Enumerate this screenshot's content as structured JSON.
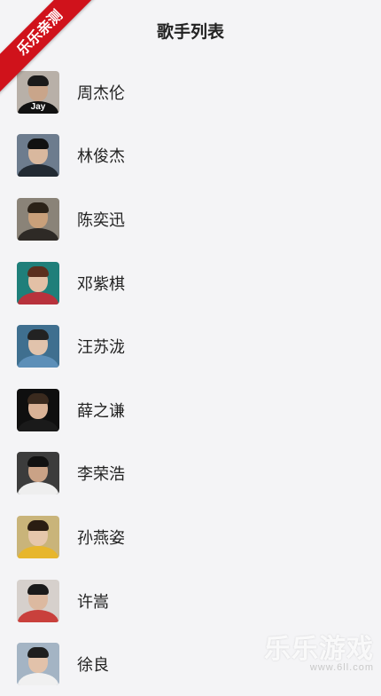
{
  "header": {
    "title": "歌手列表"
  },
  "ribbon": {
    "label": "乐乐亲测"
  },
  "singers": [
    {
      "name": "周杰伦",
      "tag": "Jay",
      "colors": {
        "bg": "#b8b0a8",
        "hair": "#1a1a1a",
        "skin": "#c9a58a",
        "cloth": "#111111"
      }
    },
    {
      "name": "林俊杰",
      "tag": "",
      "colors": {
        "bg": "#6d7c8e",
        "hair": "#111111",
        "skin": "#d9b89e",
        "cloth": "#222a33"
      }
    },
    {
      "name": "陈奕迅",
      "tag": "",
      "colors": {
        "bg": "#8a8378",
        "hair": "#2b2218",
        "skin": "#c9a07a",
        "cloth": "#2e2a26"
      }
    },
    {
      "name": "邓紫棋",
      "tag": "",
      "colors": {
        "bg": "#1f7f7a",
        "hair": "#5b2f1e",
        "skin": "#e3c0a6",
        "cloth": "#b8323c"
      }
    },
    {
      "name": "汪苏泷",
      "tag": "",
      "colors": {
        "bg": "#3f6f8f",
        "hair": "#222222",
        "skin": "#e1c3ac",
        "cloth": "#5d8fb8"
      }
    },
    {
      "name": "薛之谦",
      "tag": "",
      "colors": {
        "bg": "#0f0f0f",
        "hair": "#3a2a1e",
        "skin": "#d9b296",
        "cloth": "#1a1a1a"
      }
    },
    {
      "name": "李荣浩",
      "tag": "",
      "colors": {
        "bg": "#3c3c3c",
        "hair": "#111111",
        "skin": "#caa286",
        "cloth": "#eeeeee"
      }
    },
    {
      "name": "孙燕姿",
      "tag": "",
      "colors": {
        "bg": "#c9b47a",
        "hair": "#2a1d12",
        "skin": "#e6c7ab",
        "cloth": "#e7b62c"
      }
    },
    {
      "name": "许嵩",
      "tag": "",
      "colors": {
        "bg": "#d6d0cc",
        "hair": "#1a1a1a",
        "skin": "#dcb9a0",
        "cloth": "#c9403c"
      }
    },
    {
      "name": "徐良",
      "tag": "",
      "colors": {
        "bg": "#a4b4c4",
        "hair": "#1e1e1e",
        "skin": "#e2c2aa",
        "cloth": "#f0f0f0"
      }
    }
  ],
  "watermark": {
    "title": "乐乐游戏",
    "url": "www.6ll.com"
  }
}
